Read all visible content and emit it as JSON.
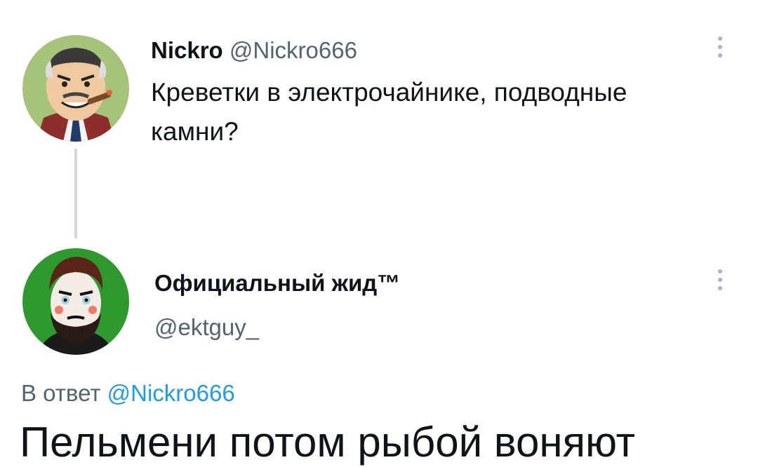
{
  "tweets": [
    {
      "display_name": "Nickro",
      "handle": "@Nickro666",
      "text": "Креветки в электрочайнике, подводные камни?",
      "avatar_icon": "cartoon-man-with-cigar-avatar"
    },
    {
      "display_name": "Официальный жид™",
      "handle": "@ektguy_",
      "avatar_icon": "bearded-man-avatar",
      "avatar_bg": "#2e9a2e"
    }
  ],
  "reply_context": {
    "prefix": "В ответ",
    "mention": "@Nickro666"
  },
  "reply_text_partial": "Пельмени потом рыбой воняют"
}
